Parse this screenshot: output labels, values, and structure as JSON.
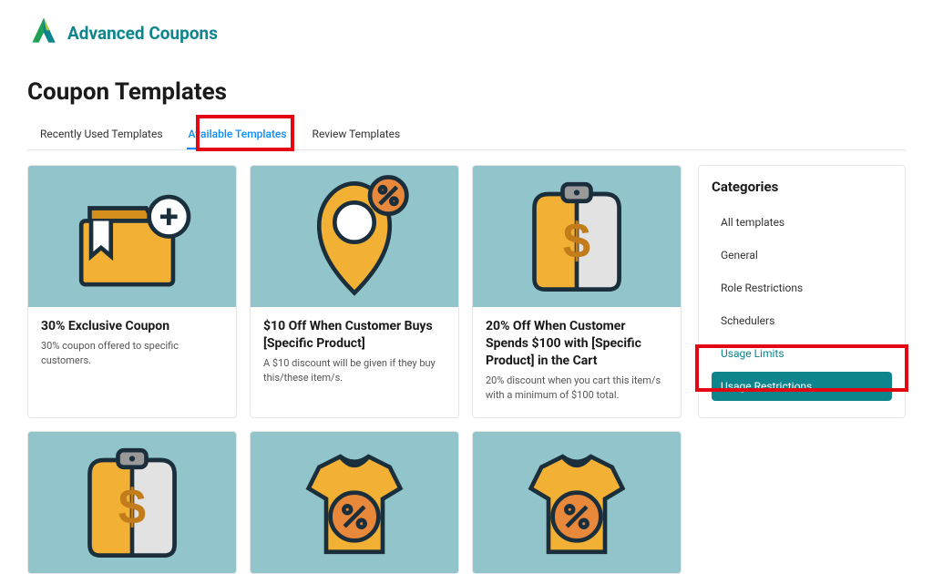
{
  "brand": "Advanced Coupons",
  "page_title": "Coupon Templates",
  "tabs": [
    {
      "label": "Recently Used Templates",
      "active": false
    },
    {
      "label": "Available Templates",
      "active": true
    },
    {
      "label": "Review Templates",
      "active": false
    }
  ],
  "cards": [
    {
      "title": "30% Exclusive Coupon",
      "desc": "30% coupon offered to specific customers."
    },
    {
      "title": "$10 Off When Customer Buys [Specific Product]",
      "desc": "A $10 discount will be given if they buy this/these item/s."
    },
    {
      "title": "20% Off When Customer Spends $100 with [Specific Product] in the Cart",
      "desc": "20% discount when you cart this item/s with a minimum of $100 total."
    }
  ],
  "sidebar": {
    "title": "Categories",
    "items": [
      "All templates",
      "General",
      "Role Restrictions",
      "Schedulers",
      "Usage Limits",
      "Usage Restrictions"
    ]
  }
}
